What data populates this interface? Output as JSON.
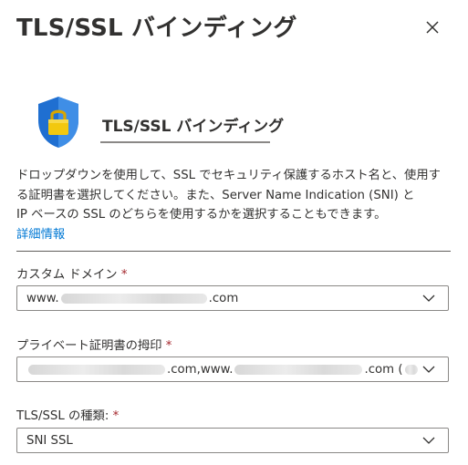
{
  "panel": {
    "title": "TLS/SSL バインディング",
    "close_label": "×"
  },
  "section": {
    "heading": "TLS/SSL バインディング",
    "icon": "shield-lock-icon",
    "description_lines": [
      "ドロップダウンを使用して、SSL でセキュリティ保護するホスト名と、使用す",
      "る証明書を選択してください。また、Server Name Indication (SNI) と",
      "IP ベースの SSL のどちらを使用するかを選択することもできます。"
    ],
    "learn_more": "詳細情報"
  },
  "fields": {
    "custom_domain": {
      "label": "カスタム ドメイン",
      "required": "*",
      "value_prefix": "www.",
      "value_suffix": ".com"
    },
    "thumbprint": {
      "label": "プライベート証明書の拇印",
      "required": "*",
      "value_part1": ".com,www.",
      "value_part2": ".com ("
    },
    "tls_type": {
      "label": "TLS/SSL の種類:",
      "required": "*",
      "value": "SNI SSL"
    }
  },
  "colors": {
    "link": "#0078d4",
    "required": "#a4262c",
    "shield_blue": "#1f6fd1",
    "lock_gold": "#f2c80f"
  }
}
